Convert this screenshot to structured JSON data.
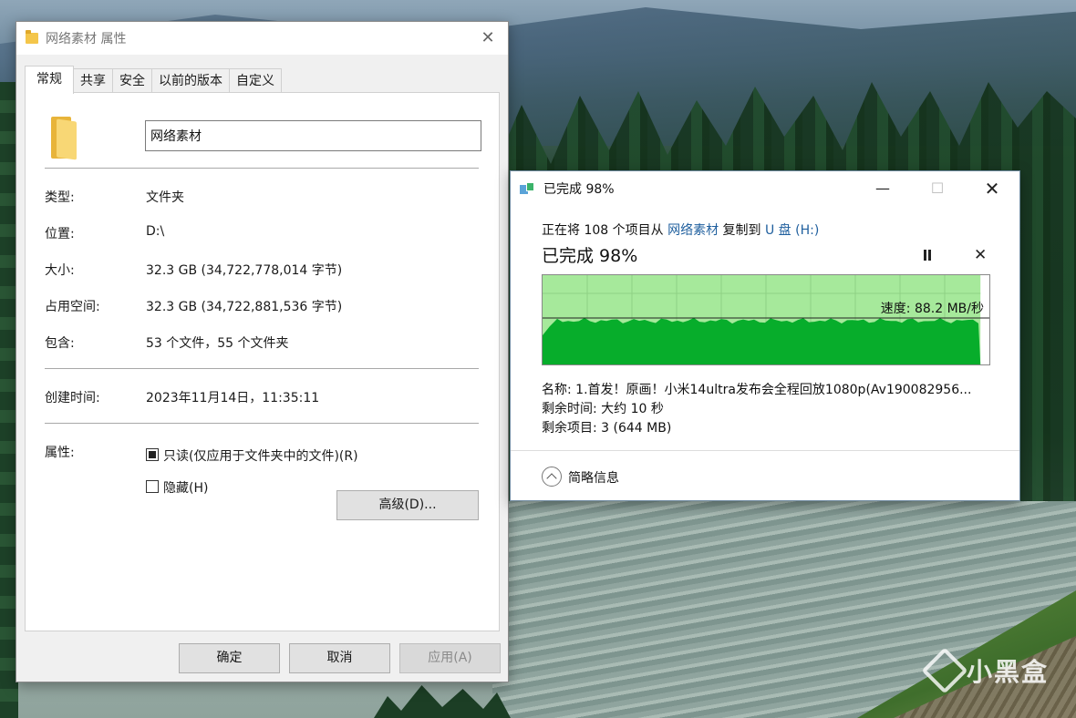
{
  "wallpaper": {
    "watermark_text": "小黑盒"
  },
  "properties_dialog": {
    "title": "网络素材 属性",
    "tabs": [
      "常规",
      "共享",
      "安全",
      "以前的版本",
      "自定义"
    ],
    "active_tab": "常规",
    "name_value": "网络素材",
    "rows": {
      "type": {
        "label": "类型:",
        "value": "文件夹"
      },
      "location": {
        "label": "位置:",
        "value": "D:\\"
      },
      "size": {
        "label": "大小:",
        "value": "32.3 GB (34,722,778,014 字节)"
      },
      "size_on_disk": {
        "label": "占用空间:",
        "value": "32.3 GB (34,722,881,536 字节)"
      },
      "contains": {
        "label": "包含:",
        "value": "53 个文件，55 个文件夹"
      },
      "created": {
        "label": "创建时间:",
        "value": "2023年11月14日，11:35:11"
      }
    },
    "attributes": {
      "label": "属性:",
      "readonly_label": "只读(仅应用于文件夹中的文件)(R)",
      "hidden_label": "隐藏(H)",
      "advanced_button": "高级(D)..."
    },
    "footer": {
      "ok": "确定",
      "cancel": "取消",
      "apply": "应用(A)"
    }
  },
  "copy_dialog": {
    "title": "已完成 98%",
    "desc_prefix": "正在将 108 个项目从 ",
    "desc_source": "网络素材",
    "desc_middle": " 复制到 ",
    "desc_dest": "U 盘 (H:)",
    "percent_text": "已完成 98%",
    "progress": 0.98,
    "speed_text": "速度: 88.2 MB/秒",
    "name_line": "名称: 1.首发！原画！小米14ultra发布会全程回放1080p(Av190082956...",
    "time_left": "剩余时间: 大约 10 秒",
    "items_left": "剩余项目: 3 (644 MB)",
    "details_toggle": "简略信息",
    "colors": {
      "done_fill": "#07ad2b",
      "bg_fill": "#a6e99b",
      "grid": "#8fd184"
    }
  }
}
